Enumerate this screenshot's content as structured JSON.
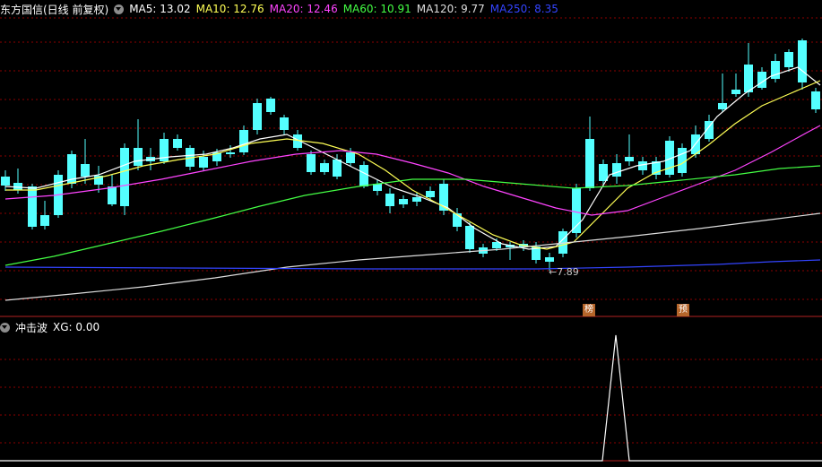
{
  "main": {
    "title": "东方国信(日线 前复权)",
    "ma": [
      {
        "label": "MA5: 13.02",
        "color": "#ffffff"
      },
      {
        "label": "MA10: 12.76",
        "color": "#ffff55"
      },
      {
        "label": "MA20: 12.46",
        "color": "#ff44ff"
      },
      {
        "label": "MA60: 10.91",
        "color": "#44ff44"
      },
      {
        "label": "MA120: 9.77",
        "color": "#dddddd"
      },
      {
        "label": "MA250: 8.35",
        "color": "#3344ff"
      }
    ],
    "low_marker": "←7.89",
    "badges": [
      "榜",
      "预"
    ]
  },
  "sub": {
    "title": "冲击波",
    "xg_label": "XG: 0.00"
  },
  "colors": {
    "up": "#ff3232",
    "down": "#54ffff",
    "grid": "#8b0000",
    "border": "#b22222"
  },
  "chart_data": {
    "type": "candlestick",
    "ma_values": {
      "MA5": 13.02,
      "MA10": 12.76,
      "MA20": 12.46,
      "MA60": 10.91,
      "MA120": 9.77,
      "MA250": 8.35
    },
    "period_low": 7.89,
    "xg_last": 0.0
  }
}
